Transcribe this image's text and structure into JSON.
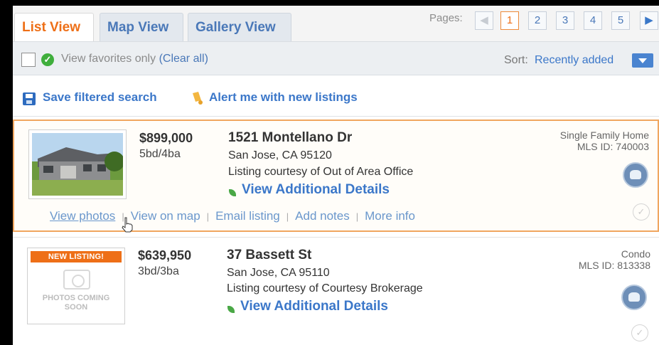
{
  "tabs": [
    {
      "label": "List View",
      "active": true
    },
    {
      "label": "Map View",
      "active": false
    },
    {
      "label": "Gallery View",
      "active": false
    }
  ],
  "pagination": {
    "label": "Pages:",
    "pages": [
      "1",
      "2",
      "3",
      "4",
      "5"
    ],
    "current": "1"
  },
  "filter": {
    "favorites_label": "View favorites only",
    "clear_all": "(Clear all)",
    "sort_label": "Sort:",
    "sort_value": "Recently added"
  },
  "actions_bar": {
    "save_search": "Save filtered search",
    "alert_me": "Alert me with new listings"
  },
  "listings": [
    {
      "price": "$899,000",
      "beds_baths": "5bd/4ba",
      "address": "1521 Montellano Dr",
      "city": "San Jose, CA  95120",
      "courtesy": "Listing courtesy of Out of Area Office",
      "details": "View Additional Details",
      "property_type": "Single Family Home",
      "mls": "MLS ID: 740003",
      "actions": [
        "View photos",
        "View on map",
        "Email listing",
        "Add notes",
        "More info"
      ]
    },
    {
      "price": "$639,950",
      "beds_baths": "3bd/3ba",
      "address": "37 Bassett St",
      "city": "San Jose, CA  95110",
      "courtesy": "Listing courtesy of Courtesy Brokerage",
      "details": "View Additional Details",
      "property_type": "Condo",
      "mls": "MLS ID: 813338",
      "badge": "NEW LISTING!",
      "placeholder": "PHOTOS COMING SOON"
    }
  ],
  "colors": {
    "accent": "#ee6f17",
    "link": "#3b77c9",
    "highlight_border": "#f0a65f"
  }
}
